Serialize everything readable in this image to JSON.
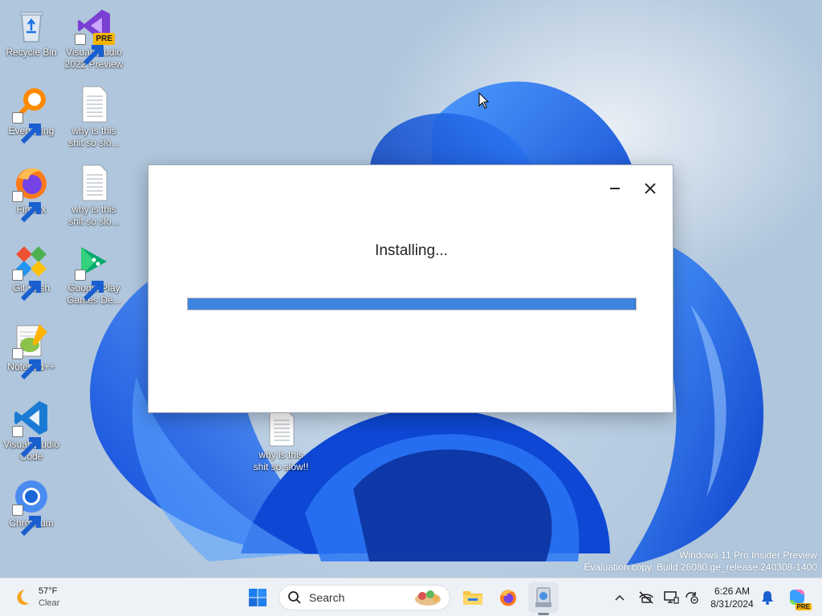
{
  "colors": {
    "accent": "#3c84e0",
    "window_bg": "#ffffff",
    "taskbar_bg": "#eef1f6",
    "wallpaper_blue": "#1f63e6"
  },
  "desktop": {
    "icons": [
      {
        "label": "Recycle Bin",
        "icon": "recycle-bin-icon"
      },
      {
        "label": "Visual Studio 2022 Preview",
        "icon": "visual-studio-icon",
        "badge": "PRE"
      },
      {
        "label": "Everything",
        "icon": "everything-search-icon"
      },
      {
        "label": "why is this shit so slo...",
        "icon": "text-document-icon"
      },
      {
        "label": "Firefox",
        "icon": "firefox-icon"
      },
      {
        "label": "why is this shit so slo...",
        "icon": "text-document-icon"
      },
      {
        "label": "Git Bash",
        "icon": "git-bash-icon"
      },
      {
        "label": "Google Play Games De...",
        "icon": "google-play-games-icon"
      },
      {
        "label": "Notepad++",
        "icon": "notepad-plus-plus-icon"
      },
      {
        "label": "Visual Studio Code",
        "icon": "vscode-icon"
      },
      {
        "label": "Chromium",
        "icon": "chromium-icon"
      },
      {
        "label": "why is this shit so slow!!",
        "icon": "text-document-icon"
      }
    ]
  },
  "installer": {
    "minimize_icon": "minimize-icon",
    "close_icon": "close-icon",
    "status": "Installing...",
    "progress_fraction": 1.0
  },
  "watermark": {
    "line1": "Windows 11 Pro Insider Preview",
    "line2": "Evaluation copy. Build 26080.ge_release.240308-1400"
  },
  "taskbar": {
    "weather": {
      "temp": "57°F",
      "condition": "Clear",
      "icon": "moon-icon"
    },
    "search_placeholder": "Search",
    "apps": [
      {
        "name": "start",
        "icon": "windows-start-icon"
      },
      {
        "name": "file-explorer",
        "icon": "folder-icon"
      },
      {
        "name": "firefox",
        "icon": "firefox-icon"
      },
      {
        "name": "setup",
        "icon": "installer-icon",
        "active": true
      }
    ],
    "tray": {
      "chevron_icon": "chevron-up-icon",
      "network_icon": "network-offline-icon",
      "display_icon": "display-icon",
      "sync_icon": "sync-icon",
      "time": "6:26 AM",
      "date": "8/31/2024",
      "bell_icon": "bell-icon",
      "copilot_badge": "PRE"
    }
  }
}
